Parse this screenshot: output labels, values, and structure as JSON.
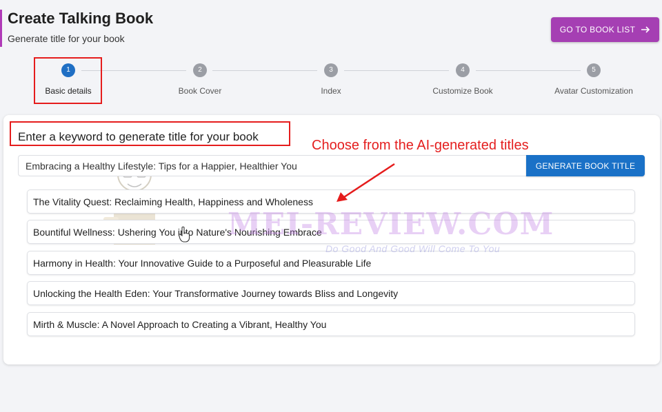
{
  "header": {
    "title": "Create Talking Book",
    "subtitle": "Generate title for your book",
    "book_list_button": "GO TO BOOK LIST"
  },
  "stepper": {
    "steps": [
      {
        "number": "1",
        "label": "Basic details"
      },
      {
        "number": "2",
        "label": "Book Cover"
      },
      {
        "number": "3",
        "label": "Index"
      },
      {
        "number": "4",
        "label": "Customize Book"
      },
      {
        "number": "5",
        "label": "Avatar Customization"
      }
    ]
  },
  "form": {
    "prompt_label": "Enter a keyword to generate title for your book",
    "keyword_value": "Embracing a Healthy Lifestyle: Tips for a Happier, Healthier You",
    "generate_button": "GENERATE BOOK TITLE"
  },
  "annotation": {
    "callout": "Choose from the AI-generated titles"
  },
  "titles": [
    "The Vitality Quest: Reclaiming Health, Happiness and Wholeness",
    "Bountiful Wellness: Ushering You into Nature's Nourishing Embrace",
    "Harmony in Health: Your Innovative Guide to a Purposeful and Pleasurable Life",
    "Unlocking the Health Eden: Your Transformative Journey towards Bliss and Longevity",
    "Mirth & Muscle: A Novel Approach to Creating a Vibrant, Healthy You"
  ],
  "watermark": {
    "text": "MEI-REVIEW.COM",
    "tagline": "Do Good And Good Will Come To You"
  },
  "colors": {
    "accent": "#a53fb3",
    "primary": "#1a71c7",
    "highlight": "#e51c1c"
  }
}
